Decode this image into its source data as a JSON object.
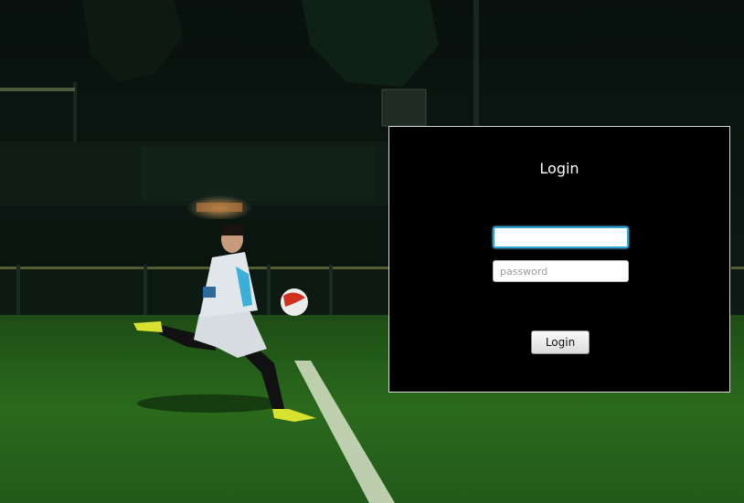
{
  "dialog": {
    "title": "Login",
    "username": {
      "value": "",
      "placeholder": ""
    },
    "password": {
      "value": "",
      "placeholder": "password"
    },
    "submit_label": "Login"
  },
  "background": {
    "description_icon": "football-goalkeeper-photo"
  },
  "colors": {
    "dialog_background": "#000000",
    "dialog_border": "#d8d8d8",
    "focus_ring": "#2aa4d8",
    "title_text": "#ffffff"
  }
}
